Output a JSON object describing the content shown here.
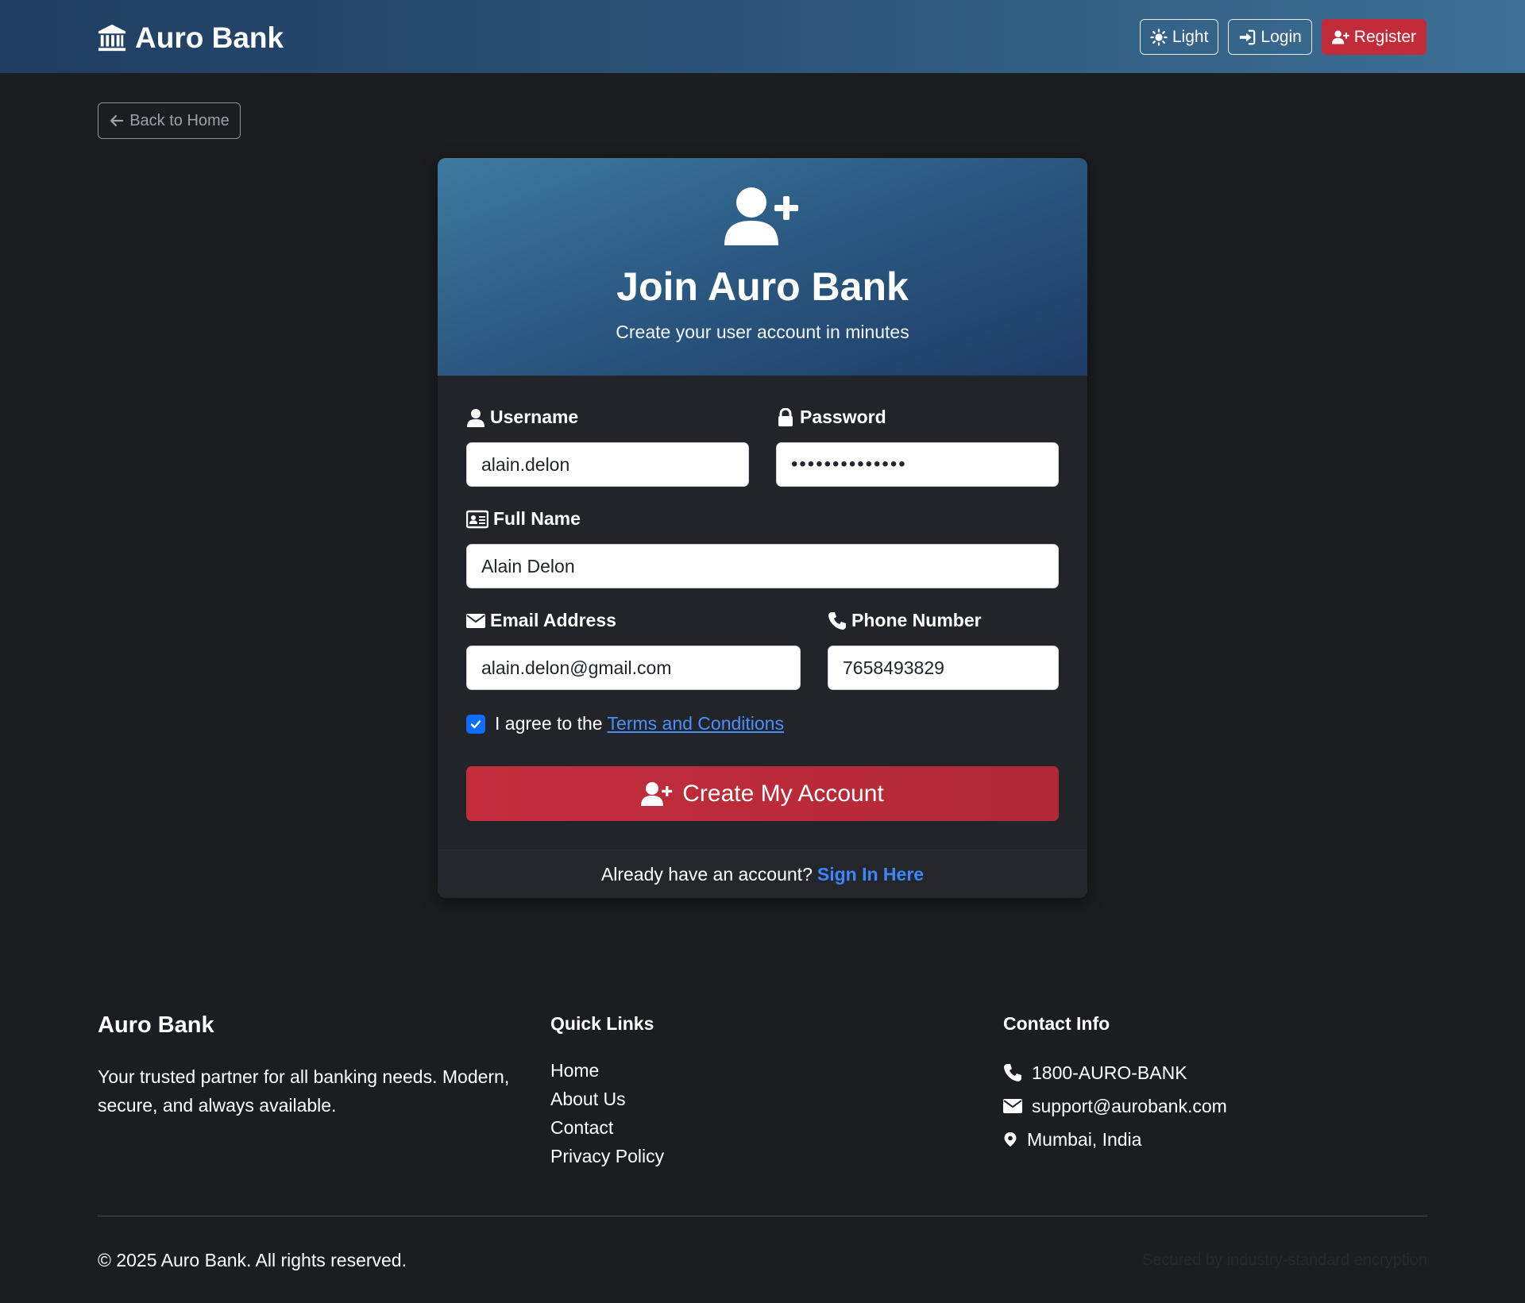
{
  "navbar": {
    "brand": "Auro Bank",
    "theme_label": "Light",
    "login_label": "Login",
    "register_label": "Register"
  },
  "back_label": "Back to Home",
  "card": {
    "title": "Join Auro Bank",
    "subtitle": "Create your user account in minutes",
    "fields": {
      "username": {
        "label": "Username",
        "value": "alain.delon"
      },
      "password": {
        "label": "Password",
        "value": "••••••••••••••"
      },
      "full_name": {
        "label": "Full Name",
        "value": "Alain Delon"
      },
      "email": {
        "label": "Email Address",
        "value": "alain.delon@gmail.com"
      },
      "phone": {
        "label": "Phone Number",
        "value": "7658493829"
      }
    },
    "agree_text": "I agree to the",
    "terms_link": "Terms and Conditions",
    "agree_checked": true,
    "submit_label": "Create My Account",
    "footer_text": "Already have an account?",
    "signin_link": "Sign In Here"
  },
  "footer": {
    "brand": "Auro Bank",
    "description": "Your trusted partner for all banking needs. Modern, secure, and always available.",
    "quick_links_title": "Quick Links",
    "quick_links": [
      "Home",
      "About Us",
      "Contact",
      "Privacy Policy"
    ],
    "contact_title": "Contact Info",
    "phone": "1800-AURO-BANK",
    "email": "support@aurobank.com",
    "location": "Mumbai, India",
    "copyright": "© 2025 Auro Bank. All rights reserved.",
    "secure_note": "Secured by industry-standard encryption"
  },
  "colors": {
    "page_bg": "#1b1d20",
    "card_bg": "#212529",
    "accent_red": "#c22b3a",
    "link_blue": "#3d86ff",
    "header_gradient_start": "#3e7aa0",
    "header_gradient_end": "#1d3c66"
  },
  "icons": {
    "brand": "bank-icon",
    "theme": "sun-icon",
    "login": "sign-in-icon",
    "register": "user-plus-icon",
    "back": "arrow-left-icon",
    "username": "user-icon",
    "password": "lock-icon",
    "full_name": "id-card-icon",
    "email": "envelope-icon",
    "phone": "phone-icon",
    "location": "map-marker-icon"
  }
}
